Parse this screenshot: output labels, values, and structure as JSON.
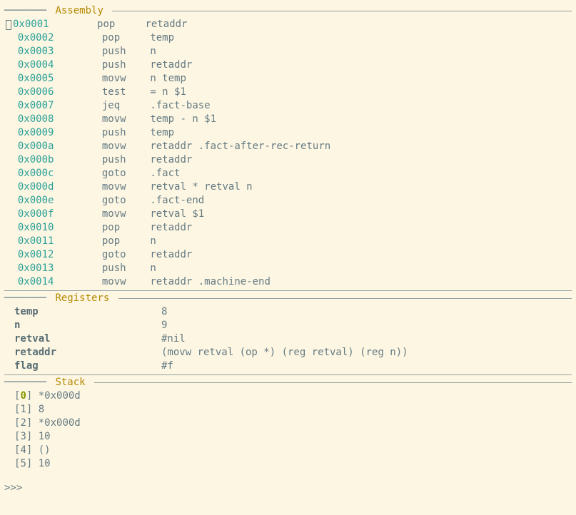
{
  "panels": {
    "assembly_title": "Assembly",
    "registers_title": "Registers",
    "stack_title": "Stack"
  },
  "assembly": [
    {
      "current": true,
      "addr": "0x0001",
      "instr": "pop",
      "args": "retaddr"
    },
    {
      "current": false,
      "addr": "0x0002",
      "instr": "pop",
      "args": "temp"
    },
    {
      "current": false,
      "addr": "0x0003",
      "instr": "push",
      "args": "n"
    },
    {
      "current": false,
      "addr": "0x0004",
      "instr": "push",
      "args": "retaddr"
    },
    {
      "current": false,
      "addr": "0x0005",
      "instr": "movw",
      "args": "n temp"
    },
    {
      "current": false,
      "addr": "0x0006",
      "instr": "test",
      "args": "= n $1"
    },
    {
      "current": false,
      "addr": "0x0007",
      "instr": "jeq",
      "args": ".fact-base"
    },
    {
      "current": false,
      "addr": "0x0008",
      "instr": "movw",
      "args": "temp - n $1"
    },
    {
      "current": false,
      "addr": "0x0009",
      "instr": "push",
      "args": "temp"
    },
    {
      "current": false,
      "addr": "0x000a",
      "instr": "movw",
      "args": "retaddr .fact-after-rec-return"
    },
    {
      "current": false,
      "addr": "0x000b",
      "instr": "push",
      "args": "retaddr"
    },
    {
      "current": false,
      "addr": "0x000c",
      "instr": "goto",
      "args": ".fact"
    },
    {
      "current": false,
      "addr": "0x000d",
      "instr": "movw",
      "args": "retval * retval n"
    },
    {
      "current": false,
      "addr": "0x000e",
      "instr": "goto",
      "args": ".fact-end"
    },
    {
      "current": false,
      "addr": "0x000f",
      "instr": "movw",
      "args": "retval $1"
    },
    {
      "current": false,
      "addr": "0x0010",
      "instr": "pop",
      "args": "retaddr"
    },
    {
      "current": false,
      "addr": "0x0011",
      "instr": "pop",
      "args": "n"
    },
    {
      "current": false,
      "addr": "0x0012",
      "instr": "goto",
      "args": "retaddr"
    },
    {
      "current": false,
      "addr": "0x0013",
      "instr": "push",
      "args": "n"
    },
    {
      "current": false,
      "addr": "0x0014",
      "instr": "movw",
      "args": "retaddr .machine-end"
    }
  ],
  "registers": [
    {
      "name": "temp",
      "value": "8"
    },
    {
      "name": "n",
      "value": "9"
    },
    {
      "name": "retval",
      "value": "#nil"
    },
    {
      "name": "retaddr",
      "value": "(movw retval (op *) (reg retval) (reg n))"
    },
    {
      "name": "flag",
      "value": "#f"
    }
  ],
  "stack": [
    {
      "idx": "0",
      "current": true,
      "value": "*0x000d"
    },
    {
      "idx": "1",
      "current": false,
      "value": "8"
    },
    {
      "idx": "2",
      "current": false,
      "value": "*0x000d"
    },
    {
      "idx": "3",
      "current": false,
      "value": "10"
    },
    {
      "idx": "4",
      "current": false,
      "value": "()"
    },
    {
      "idx": "5",
      "current": false,
      "value": "10"
    }
  ],
  "prompt": ">>>"
}
